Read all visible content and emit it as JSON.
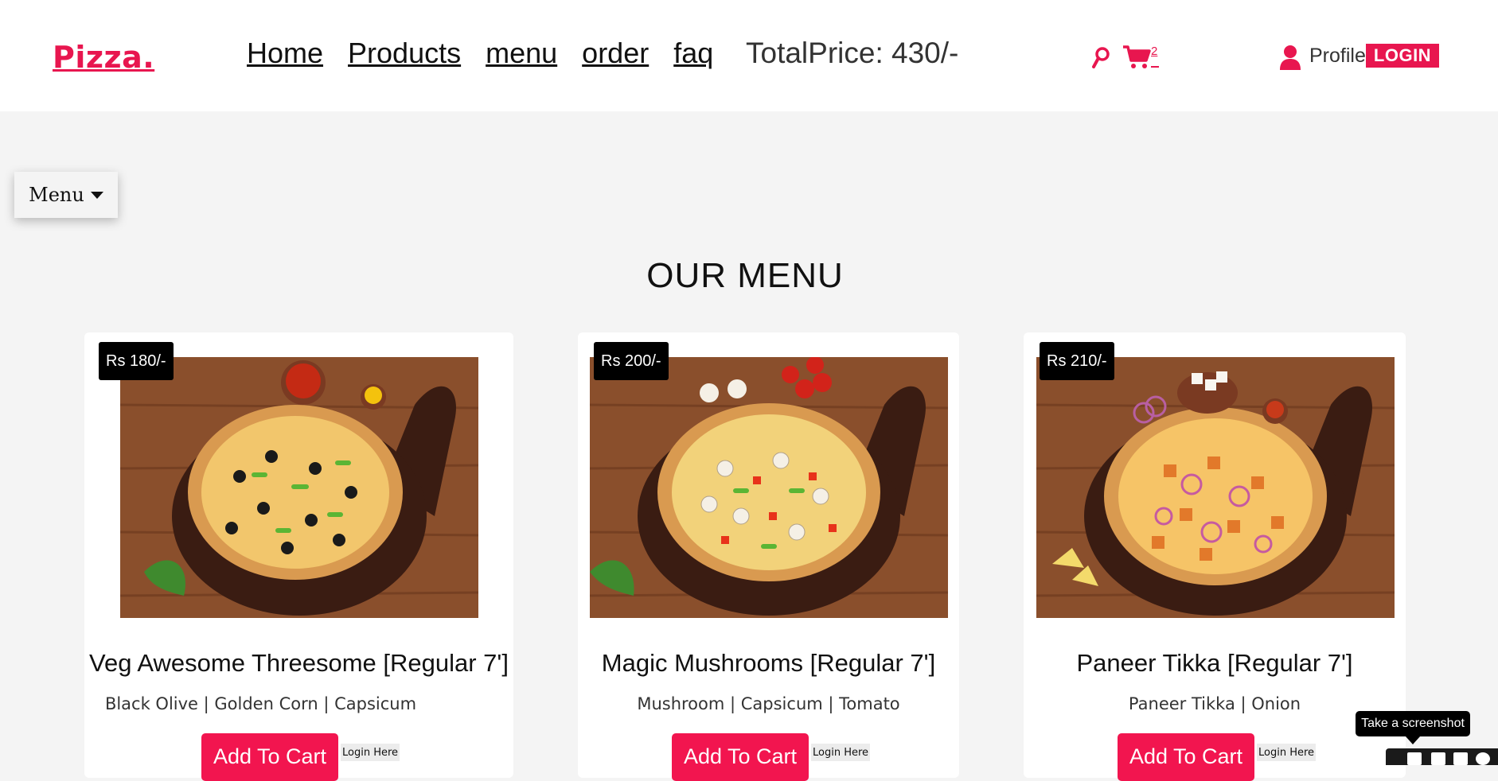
{
  "header": {
    "logo": "Pizza.",
    "nav": [
      "Home",
      "Products",
      "menu",
      "order",
      "faq"
    ],
    "total_price": "TotalPrice: 430/-",
    "cart_count": "2",
    "profile_label": "Profile",
    "login_label": "LOGIN"
  },
  "menu_dropdown": {
    "label": "Menu"
  },
  "section_title": "OUR MENU",
  "products": [
    {
      "price": "Rs 180/-",
      "name": "Veg Awesome Threesome [Regular 7']",
      "description": "Black Olive | Golden Corn | Capsicum",
      "add_label": "Add To Cart",
      "login_label": "Login Here"
    },
    {
      "price": "Rs 200/-",
      "name": "Magic Mushrooms [Regular 7']",
      "description": "Mushroom | Capsicum | Tomato",
      "add_label": "Add To Cart",
      "login_label": "Login Here"
    },
    {
      "price": "Rs 210/-",
      "name": "Paneer Tikka [Regular 7']",
      "description": "Paneer Tikka | Onion",
      "add_label": "Add To Cart",
      "login_label": "Login Here"
    }
  ],
  "tooltip": "Take a screenshot",
  "colors": {
    "accent": "#e8164f",
    "background": "#f4f4f4",
    "price_badge": "#000000"
  }
}
